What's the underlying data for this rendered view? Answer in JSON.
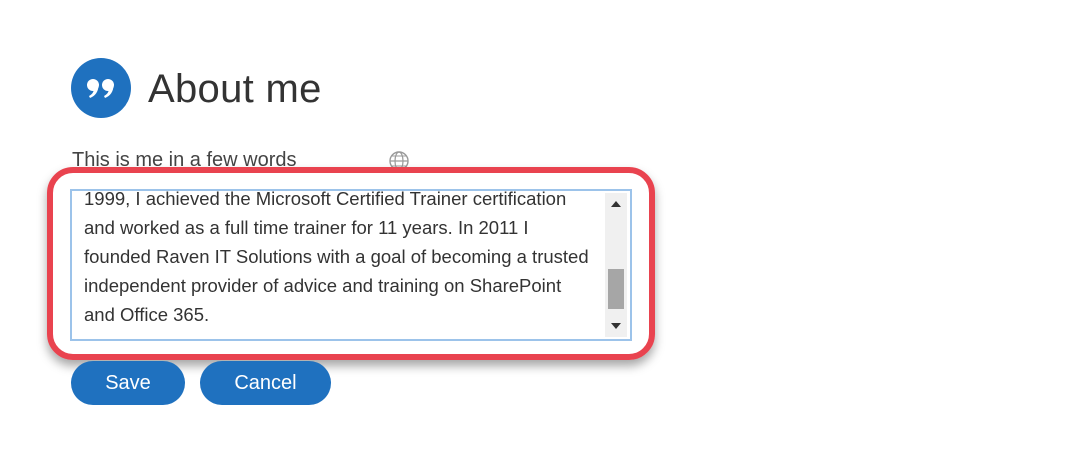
{
  "header": {
    "icon": "quote-icon",
    "title": "About me"
  },
  "field": {
    "label": "This is me in a few words",
    "visibility_icon": "globe-icon",
    "text": "1999, I achieved the Microsoft Certified Trainer certification and worked as a full time trainer for 11 years. In 2011 I founded Raven IT Solutions with a goal of becoming a trusted independent provider of advice and training on SharePoint and Office 365."
  },
  "buttons": {
    "save_label": "Save",
    "cancel_label": "Cancel"
  },
  "colors": {
    "accent": "#1f71bf",
    "highlight": "#e9434f",
    "textarea_border": "#9cc3ea"
  }
}
